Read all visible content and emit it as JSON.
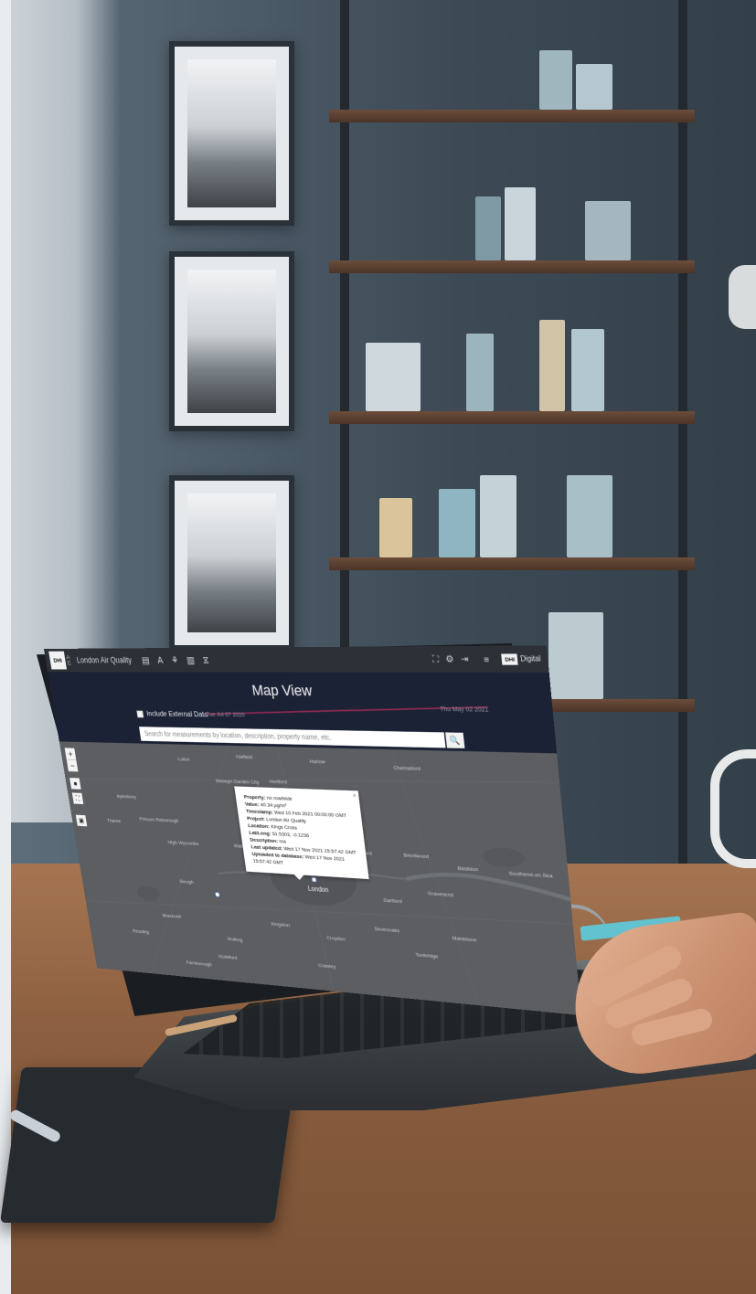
{
  "app": {
    "title": "London Air Quality",
    "logo_text": "DHI",
    "logo_sub": "A C",
    "brand_badge": "DHI",
    "brand_text": "Digital"
  },
  "toolbar": {
    "icons": [
      "map-icon",
      "text-icon",
      "community-icon",
      "document-icon",
      "hourglass-icon"
    ],
    "glyphs": [
      "▤",
      "A",
      "⚘",
      "▥",
      "⧖"
    ]
  },
  "top_right": {
    "icons": [
      "network-icon",
      "gear-icon",
      "logout-icon",
      "menu-icon"
    ],
    "glyphs": [
      "⛶",
      "⚙",
      "⇥",
      "≡"
    ]
  },
  "page": {
    "title": "Map View"
  },
  "filters": {
    "include_external_label": "Include External Data",
    "date_start": "Tue Jul 07 2020",
    "date_end": "Thu May 02 2021"
  },
  "search": {
    "placeholder": "Search for measurements by location, description, property name, etc.",
    "button_glyph": "🔍"
  },
  "map": {
    "zoom_in": "+",
    "zoom_out": "−",
    "places": [
      "Luton",
      "Hatfield",
      "Harlow",
      "Chelmsford",
      "Welwyn Garden City",
      "Hertford",
      "Aylesbury",
      "Thame",
      "Princes Risborough",
      "High Wycombe",
      "Slough",
      "Reading",
      "London",
      "Watford",
      "Gravesend",
      "Southend-on-Sea",
      "Basildon",
      "Brentwood",
      "Crawley",
      "Guildford",
      "Woking",
      "Sevenoaks",
      "Maidstone",
      "Tonbridge",
      "Bracknell",
      "Farnborough",
      "Croydon",
      "Kingston",
      "Dartford",
      "Romford"
    ],
    "popup": {
      "property_label": "Property:",
      "property_value": "no roadside",
      "value_label": "Value:",
      "value_value": "40.34 µg/m³",
      "timestamp_label": "Timestamp:",
      "timestamp_value": "Wed 10 Feb 2021 00:00:00 GMT",
      "project_label": "Project:",
      "project_value": "London Air Quality",
      "location_label": "Location:",
      "location_value": "Kings Cross",
      "latlong_label": "Lat/Long:",
      "latlong_value": "51.5303, -0.1236",
      "description_label": "Description:",
      "description_value": "n/a",
      "last_updated_label": "Last updated:",
      "last_updated_value": "Wed 17 Nov 2021 15:57:42 GMT",
      "uploaded_label": "Uploaded to database:",
      "uploaded_value": "Wed 17 Nov 2021 15:57:42 GMT",
      "close_glyph": "×"
    }
  }
}
